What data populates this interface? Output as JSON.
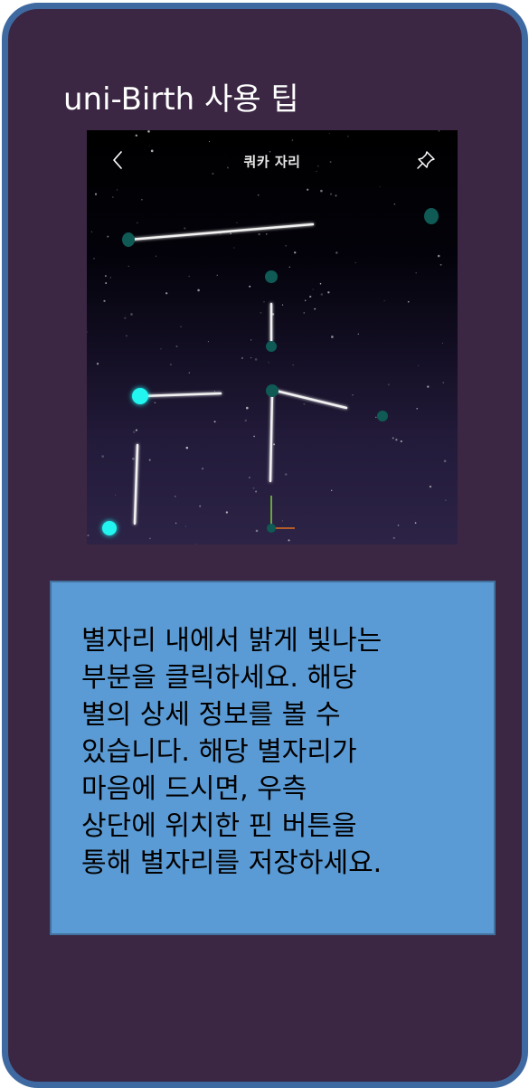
{
  "card": {
    "title": "uni-Birth 사용 팁"
  },
  "screenshot": {
    "header_title": "쿼카 자리",
    "back_icon": "chevron-left-icon",
    "pin_icon": "pin-icon"
  },
  "tip": {
    "text": "별자리 내에서 밝게 빛나는\n부분을 클릭하세요. 해당\n별의 상세 정보를 볼 수\n있습니다. 해당 별자리가\n마음에 드시면, 우측\n상단에 위치한 핀 버튼을\n통해 별자리를 저장하세요."
  },
  "colors": {
    "frame_border": "#3f6aa1",
    "frame_background": "#3b2743",
    "tip_background": "#5b9bd5",
    "star_dim": "#0f5a55",
    "star_bright": "#22f5f0"
  }
}
